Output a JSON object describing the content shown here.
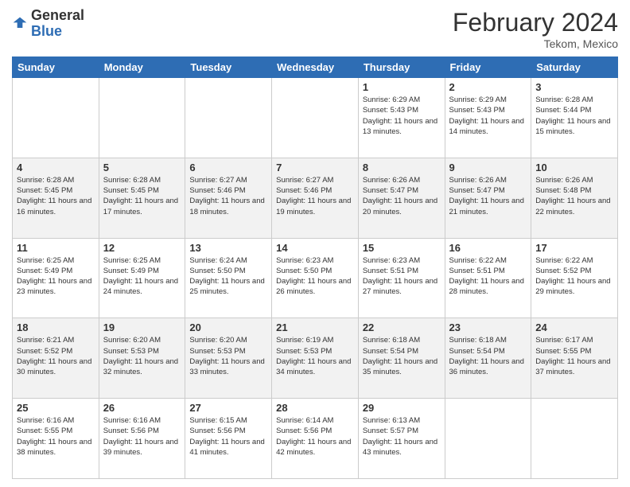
{
  "header": {
    "logo_general": "General",
    "logo_blue": "Blue",
    "title": "February 2024",
    "location": "Tekom, Mexico"
  },
  "days_of_week": [
    "Sunday",
    "Monday",
    "Tuesday",
    "Wednesday",
    "Thursday",
    "Friday",
    "Saturday"
  ],
  "weeks": [
    [
      {
        "day": "",
        "info": ""
      },
      {
        "day": "",
        "info": ""
      },
      {
        "day": "",
        "info": ""
      },
      {
        "day": "",
        "info": ""
      },
      {
        "day": "1",
        "info": "Sunrise: 6:29 AM\nSunset: 5:43 PM\nDaylight: 11 hours and 13 minutes."
      },
      {
        "day": "2",
        "info": "Sunrise: 6:29 AM\nSunset: 5:43 PM\nDaylight: 11 hours and 14 minutes."
      },
      {
        "day": "3",
        "info": "Sunrise: 6:28 AM\nSunset: 5:44 PM\nDaylight: 11 hours and 15 minutes."
      }
    ],
    [
      {
        "day": "4",
        "info": "Sunrise: 6:28 AM\nSunset: 5:45 PM\nDaylight: 11 hours and 16 minutes."
      },
      {
        "day": "5",
        "info": "Sunrise: 6:28 AM\nSunset: 5:45 PM\nDaylight: 11 hours and 17 minutes."
      },
      {
        "day": "6",
        "info": "Sunrise: 6:27 AM\nSunset: 5:46 PM\nDaylight: 11 hours and 18 minutes."
      },
      {
        "day": "7",
        "info": "Sunrise: 6:27 AM\nSunset: 5:46 PM\nDaylight: 11 hours and 19 minutes."
      },
      {
        "day": "8",
        "info": "Sunrise: 6:26 AM\nSunset: 5:47 PM\nDaylight: 11 hours and 20 minutes."
      },
      {
        "day": "9",
        "info": "Sunrise: 6:26 AM\nSunset: 5:47 PM\nDaylight: 11 hours and 21 minutes."
      },
      {
        "day": "10",
        "info": "Sunrise: 6:26 AM\nSunset: 5:48 PM\nDaylight: 11 hours and 22 minutes."
      }
    ],
    [
      {
        "day": "11",
        "info": "Sunrise: 6:25 AM\nSunset: 5:49 PM\nDaylight: 11 hours and 23 minutes."
      },
      {
        "day": "12",
        "info": "Sunrise: 6:25 AM\nSunset: 5:49 PM\nDaylight: 11 hours and 24 minutes."
      },
      {
        "day": "13",
        "info": "Sunrise: 6:24 AM\nSunset: 5:50 PM\nDaylight: 11 hours and 25 minutes."
      },
      {
        "day": "14",
        "info": "Sunrise: 6:23 AM\nSunset: 5:50 PM\nDaylight: 11 hours and 26 minutes."
      },
      {
        "day": "15",
        "info": "Sunrise: 6:23 AM\nSunset: 5:51 PM\nDaylight: 11 hours and 27 minutes."
      },
      {
        "day": "16",
        "info": "Sunrise: 6:22 AM\nSunset: 5:51 PM\nDaylight: 11 hours and 28 minutes."
      },
      {
        "day": "17",
        "info": "Sunrise: 6:22 AM\nSunset: 5:52 PM\nDaylight: 11 hours and 29 minutes."
      }
    ],
    [
      {
        "day": "18",
        "info": "Sunrise: 6:21 AM\nSunset: 5:52 PM\nDaylight: 11 hours and 30 minutes."
      },
      {
        "day": "19",
        "info": "Sunrise: 6:20 AM\nSunset: 5:53 PM\nDaylight: 11 hours and 32 minutes."
      },
      {
        "day": "20",
        "info": "Sunrise: 6:20 AM\nSunset: 5:53 PM\nDaylight: 11 hours and 33 minutes."
      },
      {
        "day": "21",
        "info": "Sunrise: 6:19 AM\nSunset: 5:53 PM\nDaylight: 11 hours and 34 minutes."
      },
      {
        "day": "22",
        "info": "Sunrise: 6:18 AM\nSunset: 5:54 PM\nDaylight: 11 hours and 35 minutes."
      },
      {
        "day": "23",
        "info": "Sunrise: 6:18 AM\nSunset: 5:54 PM\nDaylight: 11 hours and 36 minutes."
      },
      {
        "day": "24",
        "info": "Sunrise: 6:17 AM\nSunset: 5:55 PM\nDaylight: 11 hours and 37 minutes."
      }
    ],
    [
      {
        "day": "25",
        "info": "Sunrise: 6:16 AM\nSunset: 5:55 PM\nDaylight: 11 hours and 38 minutes."
      },
      {
        "day": "26",
        "info": "Sunrise: 6:16 AM\nSunset: 5:56 PM\nDaylight: 11 hours and 39 minutes."
      },
      {
        "day": "27",
        "info": "Sunrise: 6:15 AM\nSunset: 5:56 PM\nDaylight: 11 hours and 41 minutes."
      },
      {
        "day": "28",
        "info": "Sunrise: 6:14 AM\nSunset: 5:56 PM\nDaylight: 11 hours and 42 minutes."
      },
      {
        "day": "29",
        "info": "Sunrise: 6:13 AM\nSunset: 5:57 PM\nDaylight: 11 hours and 43 minutes."
      },
      {
        "day": "",
        "info": ""
      },
      {
        "day": "",
        "info": ""
      }
    ]
  ]
}
